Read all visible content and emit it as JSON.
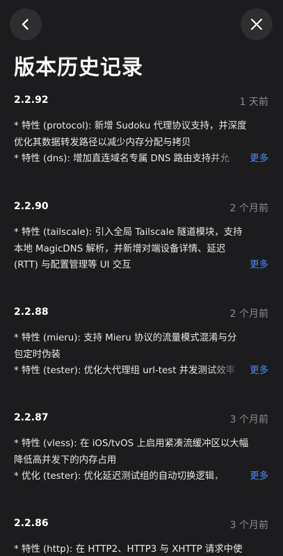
{
  "header": {
    "title": "版本历史记录"
  },
  "more_label": "更多",
  "entries": [
    {
      "version": "2.2.92",
      "date": "1 天前",
      "lines": [
        "* 特性 (protocol): 新增 Sudoku 代理协议支持，并深度",
        "优化其数据转发路径以减少内存分配与拷贝",
        "* 特性 (dns): 增加直连域名专属 DNS 路由支持并允"
      ]
    },
    {
      "version": "2.2.90",
      "date": "2 个月前",
      "lines": [
        "* 特性 (tailscale): 引入全局 Tailscale 隧道模块，支持",
        "本地 MagicDNS 解析，并新增对端设备详情、延迟",
        "(RTT) 与配置管理等 UI 交互"
      ]
    },
    {
      "version": "2.2.88",
      "date": "2 个月前",
      "lines": [
        "* 特性 (mieru): 支持 Mieru 协议的流量模式混淆与分",
        "包定时伪装",
        "* 特性 (tester): 优化大代理组 url-test 并发测试效率"
      ]
    },
    {
      "version": "2.2.87",
      "date": "3 个月前",
      "lines": [
        "* 特性 (vless): 在 iOS/tvOS 上启用紧凑流缓冲区以大幅",
        "降低高并发下的内存占用",
        "* 优化 (tester): 优化延迟测试组的自动切换逻辑，"
      ]
    },
    {
      "version": "2.2.86",
      "date": "3 个月前",
      "lines": [
        "* 特性 (http): 在 HTTP2、HTTP3 与 XHTTP 请求中使"
      ]
    }
  ]
}
